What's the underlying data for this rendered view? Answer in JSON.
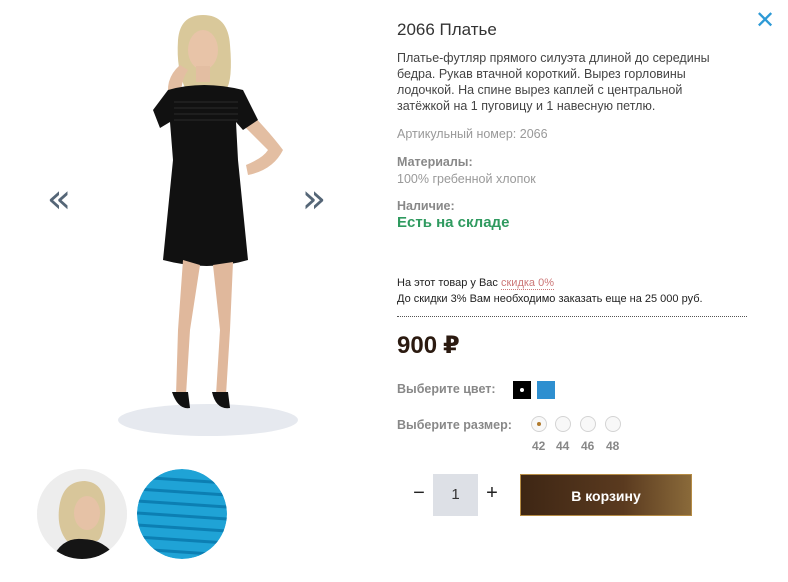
{
  "close": {
    "glyph": "✕"
  },
  "gallery": {
    "prev_glyph": "«",
    "next_glyph": "»"
  },
  "product": {
    "title": "2066 Платье",
    "description": "Платье-футляр прямого силуэта длиной до середины бедра. Рукав втачной короткий. Вырез горловины лодочкой. На спине вырез каплей с центральной затёжкой на 1 пуговицу и 1 навесную петлю.",
    "article": "Артикульный номер: 2066",
    "materials_label": "Материалы:",
    "materials_value": "100% гребенной хлопок",
    "availability_label": "Наличие:",
    "availability_value": "Есть на складе",
    "discount_text": "На этот товар у Вас ",
    "discount_link": "скидка 0%",
    "discount_note": "До скидки 3% Вам необходимо заказать еще на 25 000 руб.",
    "price": "900",
    "currency": "₽",
    "color_label": "Выберите цвет:",
    "colors": [
      "#000000",
      "#2e8fd0"
    ],
    "size_label": "Выберите размер:",
    "sizes": [
      "42",
      "44",
      "46",
      "48"
    ],
    "selected_size": "42",
    "quantity": "1",
    "qty_minus": "−",
    "qty_plus": "+",
    "cart_button": "В корзину"
  }
}
